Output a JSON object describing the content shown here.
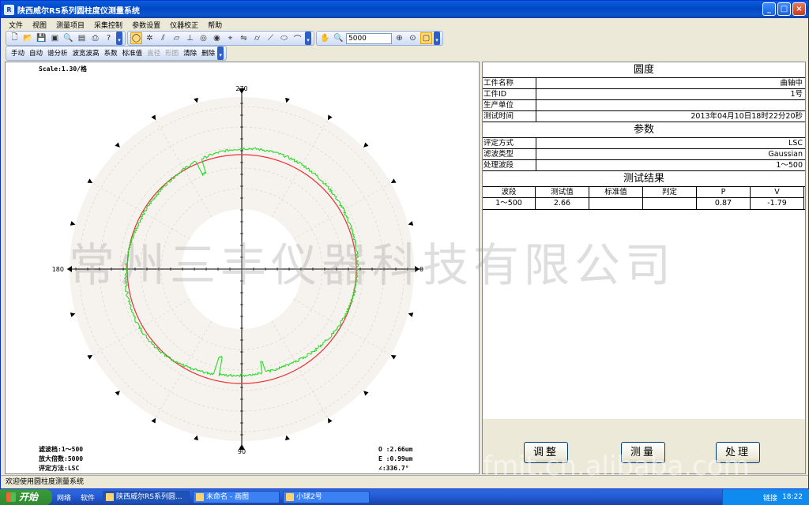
{
  "window": {
    "title": "陕西威尔RS系列圆柱度仪测量系统"
  },
  "menu": [
    "文件",
    "视图",
    "测量项目",
    "采集控制",
    "参数设置",
    "仪器校正",
    "帮助"
  ],
  "toolbar": {
    "zoom_value": "5000"
  },
  "toolbar2": [
    {
      "label": "手动",
      "disabled": false
    },
    {
      "label": "自动",
      "disabled": false
    },
    {
      "label": "谱分析",
      "disabled": false
    },
    {
      "label": "波宽波高",
      "disabled": false
    },
    {
      "label": "系数",
      "disabled": false
    },
    {
      "label": "标准值",
      "disabled": false
    },
    {
      "label": "直径",
      "disabled": true
    },
    {
      "label": "形图",
      "disabled": true
    },
    {
      "label": "清除",
      "disabled": false
    },
    {
      "label": "删除",
      "disabled": false
    }
  ],
  "plot": {
    "scale_label": "Scale:1.30/格",
    "angle_270": "270",
    "angle_180": "180",
    "angle_0": "0",
    "angle_90": "90",
    "info_filter": "滤波档:1～500",
    "info_mag": "放大倍数:5000",
    "info_method": "评定方法:LSC",
    "info_o": "O :2.66um",
    "info_e": "E :0.99um",
    "info_angle": "∠:336.7°"
  },
  "panel": {
    "title": "圆度",
    "rows": [
      {
        "key": "工件名称",
        "value": "曲轴中"
      },
      {
        "key": "工件ID",
        "value": "1号"
      },
      {
        "key": "生产单位",
        "value": ""
      },
      {
        "key": "测试时间",
        "value": "2013年04月10日18时22分20秒"
      }
    ],
    "params_title": "参数",
    "params": [
      {
        "key": "评定方式",
        "value": "LSC"
      },
      {
        "key": "滤波类型",
        "value": "Gaussian"
      },
      {
        "key": "处理波段",
        "value": "1～500"
      }
    ],
    "results_title": "测试结果",
    "results_headers": [
      "波段",
      "测试值",
      "标准值",
      "判定",
      "P",
      "V"
    ],
    "results_row": [
      "1～500",
      "2.66",
      "",
      "",
      "0.87",
      "-1.79"
    ]
  },
  "buttons": {
    "adjust": "调整",
    "measure": "测量",
    "process": "处理"
  },
  "status": "欢迎使用圆柱度测量系统",
  "watermark": "常州三丰仪器科技有限公司",
  "watermark2": "fmit.cn.alibaba.com",
  "taskbar": {
    "start": "开始",
    "quick": [
      "网络",
      "软件"
    ],
    "tasks": [
      "陕西威尔RS系列圆...",
      "未命名 - 画图",
      "小球2号"
    ],
    "tray_link": "链接",
    "clock": "18:22"
  },
  "colors": {
    "reference_circle": "#e8323c",
    "profile": "#2bd82b",
    "ring_fill": "#f6f3ee"
  }
}
